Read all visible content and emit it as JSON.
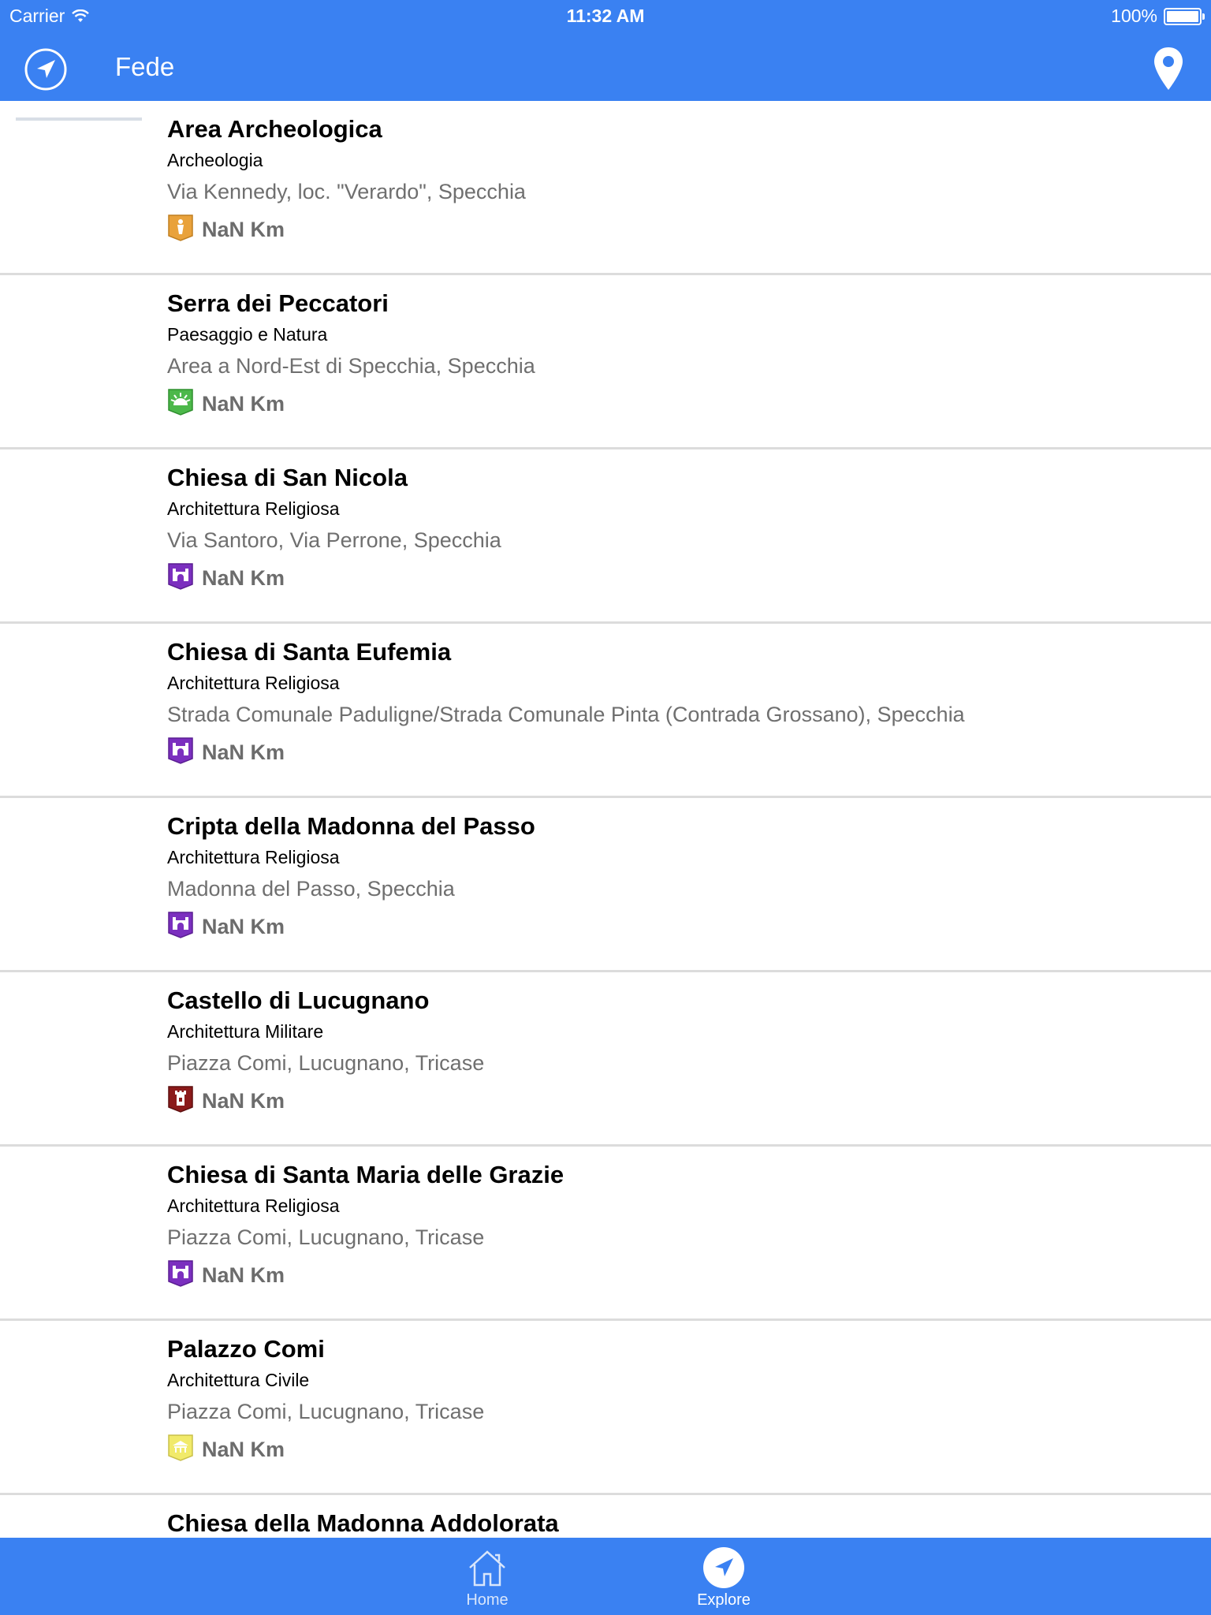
{
  "status_bar": {
    "carrier": "Carrier",
    "time": "11:32 AM",
    "battery": "100%"
  },
  "nav": {
    "title": "Fede",
    "left_icon": "navigate-icon",
    "right_icon": "map-pin-icon"
  },
  "places": [
    {
      "title": "Area Archeologica",
      "category": "Archeologia",
      "address": "Via Kennedy, loc. \"Verardo\", Specchia",
      "distance": "NaN Km",
      "icon": "archeology-icon",
      "color": "#e9a23b"
    },
    {
      "title": "Serra dei Peccatori",
      "category": "Paesaggio e Natura",
      "address": "Area a Nord-Est di Specchia, Specchia",
      "distance": "NaN Km",
      "icon": "nature-icon",
      "color": "#4cb84a"
    },
    {
      "title": "Chiesa di San Nicola",
      "category": "Architettura Religiosa",
      "address": "Via Santoro, Via Perrone, Specchia",
      "distance": "NaN Km",
      "icon": "religious-icon",
      "color": "#7b2fbf"
    },
    {
      "title": "Chiesa di Santa Eufemia",
      "category": "Architettura Religiosa",
      "address": "Strada Comunale Paduligne/Strada Comunale Pinta (Contrada Grossano), Specchia",
      "distance": "NaN Km",
      "icon": "religious-icon",
      "color": "#7b2fbf"
    },
    {
      "title": "Cripta della Madonna del Passo",
      "category": "Architettura Religiosa",
      "address": "Madonna del Passo, Specchia",
      "distance": "NaN Km",
      "icon": "religious-icon",
      "color": "#7b2fbf"
    },
    {
      "title": "Castello di Lucugnano",
      "category": "Architettura Militare",
      "address": "Piazza Comi, Lucugnano, Tricase",
      "distance": "NaN Km",
      "icon": "castle-icon",
      "color": "#8b1a1a"
    },
    {
      "title": "Chiesa di Santa Maria delle Grazie",
      "category": "Architettura Religiosa",
      "address": "Piazza Comi, Lucugnano, Tricase",
      "distance": "NaN Km",
      "icon": "religious-icon",
      "color": "#7b2fbf"
    },
    {
      "title": "Palazzo Comi",
      "category": "Architettura Civile",
      "address": "Piazza Comi, Lucugnano, Tricase",
      "distance": "NaN Km",
      "icon": "civil-icon",
      "color": "#f1ea6a"
    },
    {
      "title": "Chiesa della Madonna Addolorata",
      "category": "",
      "address": "",
      "distance": "",
      "icon": "",
      "color": ""
    }
  ],
  "tabs": [
    {
      "label": "Home",
      "icon": "home-icon"
    },
    {
      "label": "Explore",
      "icon": "explore-icon"
    }
  ]
}
